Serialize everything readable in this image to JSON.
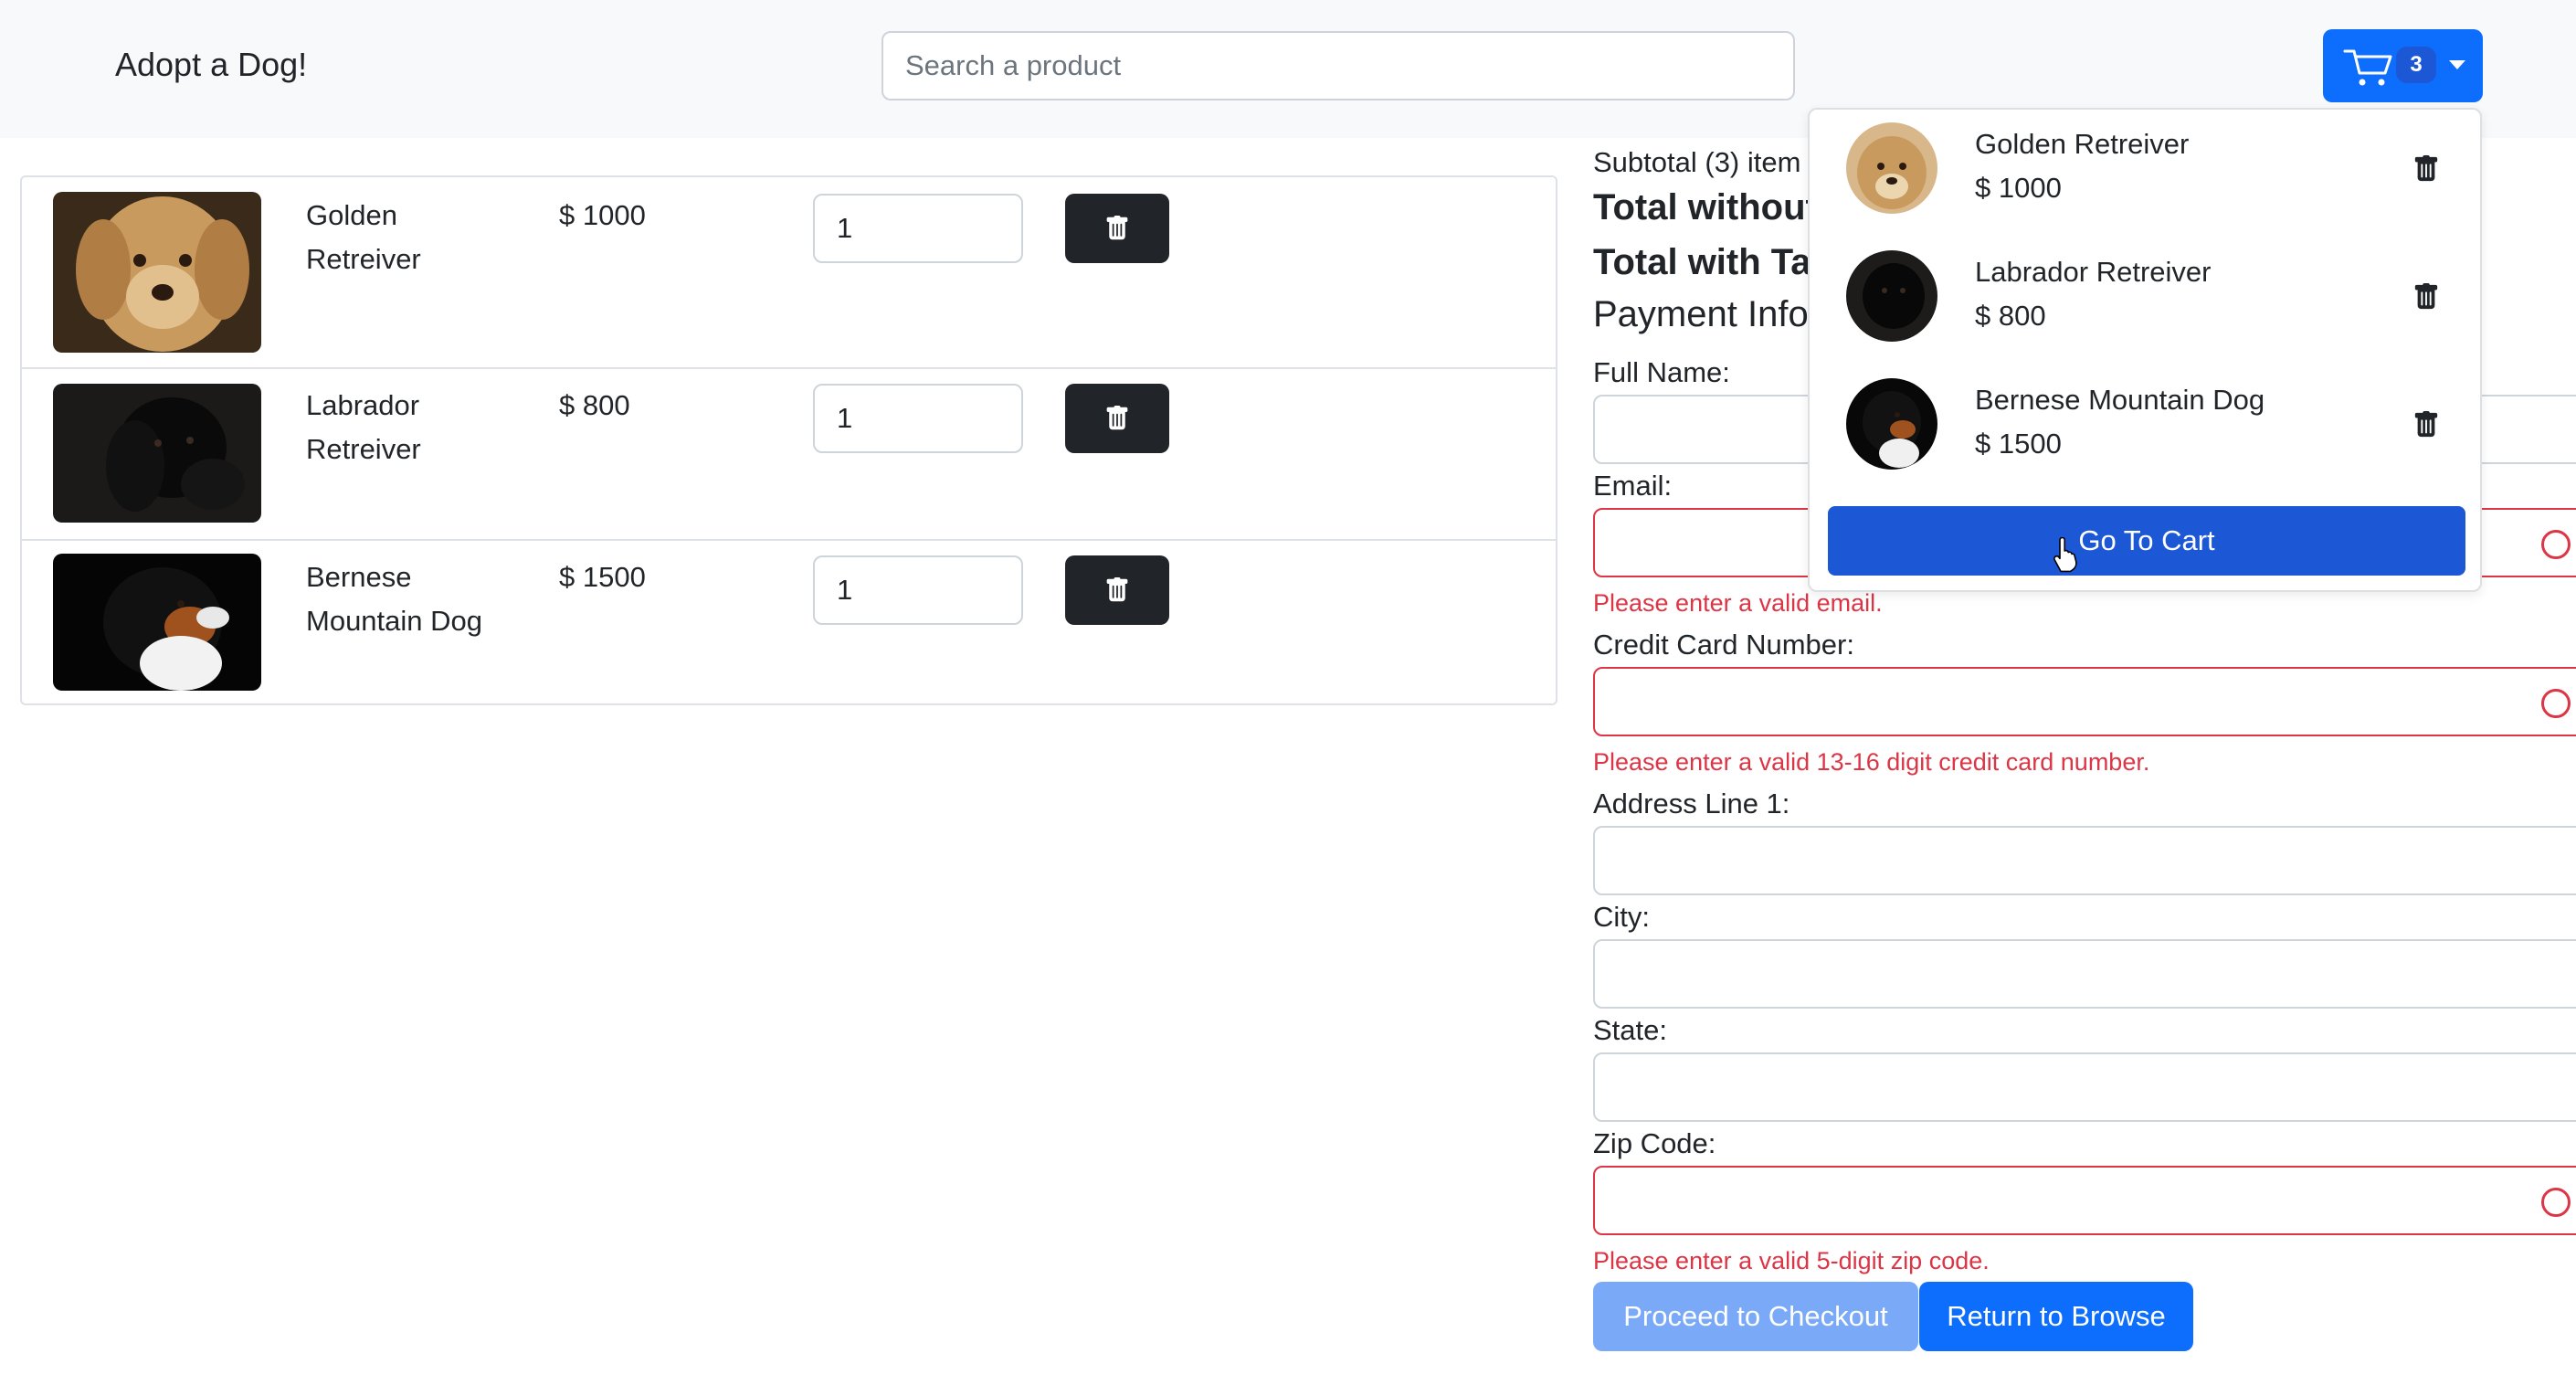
{
  "navbar": {
    "brand": "Adopt a Dog!",
    "search_placeholder": "Search a product",
    "cart_count": "3",
    "accent": "#0d6efd"
  },
  "cart_items": [
    {
      "name": "Golden Retreiver",
      "price": "$ 1000",
      "qty": "1",
      "image": "golden-retriever-photo"
    },
    {
      "name": "Labrador Retreiver",
      "price": "$ 800",
      "qty": "1",
      "image": "black-labrador-photo"
    },
    {
      "name": "Bernese Mountain Dog",
      "price": "$ 1500",
      "qty": "1",
      "image": "bernese-mountain-dog-photo"
    }
  ],
  "summary": {
    "subtotal": "Subtotal (3) item",
    "total_without": "Total without",
    "total_with": "Total with Ta",
    "payment_title": "Payment Info"
  },
  "form": {
    "full_name_label": "Full Name:",
    "email_label": "Email:",
    "email_error": "Please enter a valid email.",
    "card_label": "Credit Card Number:",
    "card_error": "Please enter a valid 13-16 digit credit card number.",
    "address_label": "Address Line 1:",
    "city_label": "City:",
    "state_label": "State:",
    "zip_label": "Zip Code:",
    "zip_error": "Please enter a valid 5-digit zip code.",
    "error_color": "#dc3545"
  },
  "buttons": {
    "checkout": "Proceed to Checkout",
    "browse": "Return to Browse"
  },
  "dropdown": {
    "items": [
      {
        "name": "Golden Retreiver",
        "price": "$ 1000"
      },
      {
        "name": "Labrador Retreiver",
        "price": "$ 800"
      },
      {
        "name": "Bernese Mountain Dog",
        "price": "$ 1500"
      }
    ],
    "go_to_cart": "Go To Cart"
  }
}
